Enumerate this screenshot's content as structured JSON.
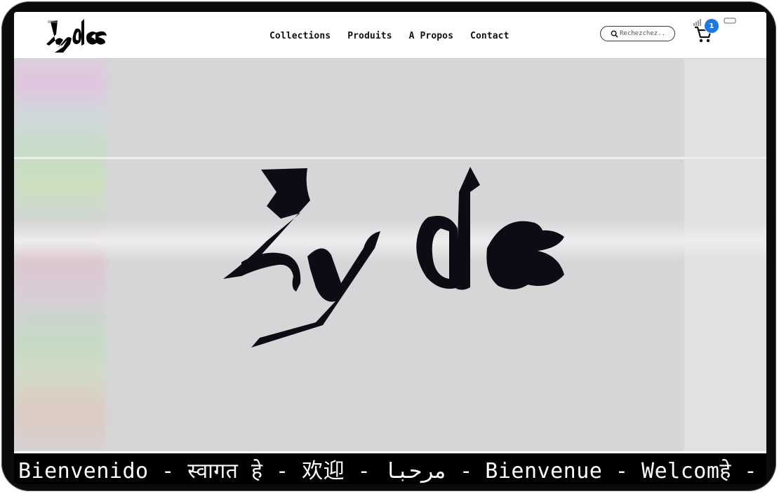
{
  "nav": {
    "items": [
      {
        "label": "Collections"
      },
      {
        "label": "Produits"
      },
      {
        "label": "A Propos"
      },
      {
        "label": "Contact"
      }
    ]
  },
  "search": {
    "placeholder": "Rechezchez.."
  },
  "cart": {
    "count": "1"
  },
  "ticker": {
    "text": "Bienvenido - स्वागत हे - 欢迎 - مرحبا - Bienvenue - Welcomहे - 欢迎"
  },
  "colors": {
    "accent": "#1c76e6",
    "ticker_bg": "#000000",
    "hero_bg": "#d6d6d8"
  }
}
